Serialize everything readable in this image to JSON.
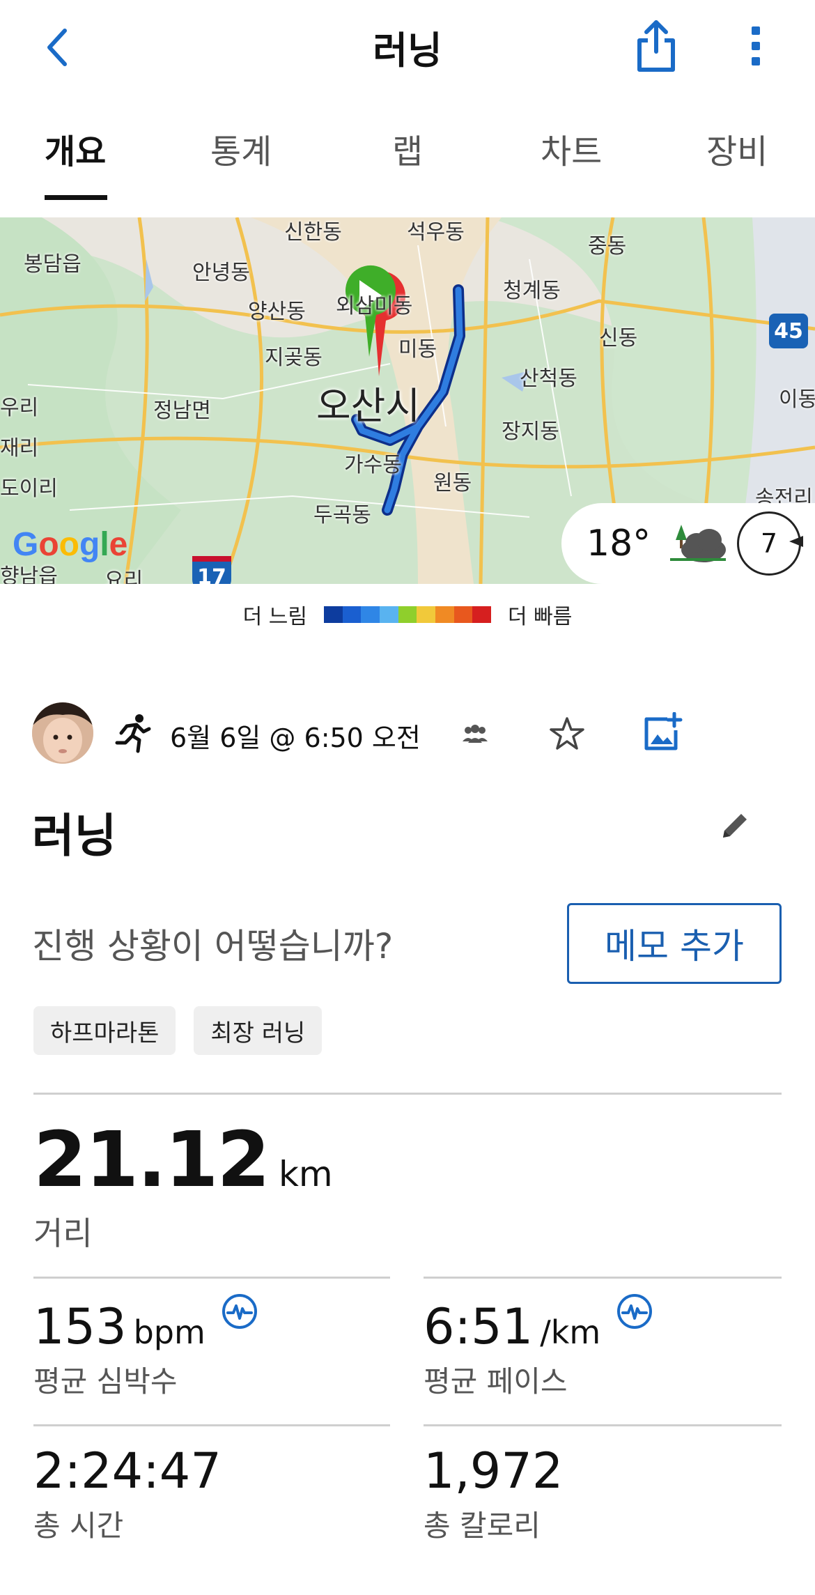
{
  "header": {
    "title": "러닝",
    "back_icon": "chevron-left-icon",
    "share_icon": "share-icon",
    "more_icon": "more-vertical-icon",
    "accent": "#1a6bc7"
  },
  "tabs": [
    {
      "label": "개요",
      "active": true
    },
    {
      "label": "통계",
      "active": false
    },
    {
      "label": "랩",
      "active": false
    },
    {
      "label": "차트",
      "active": false
    },
    {
      "label": "장비",
      "active": false
    }
  ],
  "map": {
    "city": "오산시",
    "places": [
      "신한동",
      "석우동",
      "중동",
      "봉담읍",
      "안녕동",
      "양산동",
      "외삼미동",
      "청계동",
      "지곶동",
      "미동",
      "신동",
      "산척동",
      "우리",
      "정남면",
      "이동",
      "장지동",
      "재리",
      "가수동",
      "원동",
      "도이리",
      "두곡동",
      "송전리",
      "향남읍",
      "요리"
    ],
    "route_shields": [
      "45",
      "17"
    ],
    "google_logo": "Google",
    "weather": {
      "temperature": "18°",
      "wind_speed": "7",
      "condition_icon": "cloud-tree-icon"
    }
  },
  "legend": {
    "slow_label": "더 느림",
    "fast_label": "더 빠름",
    "colors": [
      "#0d3c9e",
      "#1a5fd0",
      "#2f86e6",
      "#59b3f0",
      "#8fcf2c",
      "#f1c93a",
      "#f08a24",
      "#e8581e",
      "#d61f1f"
    ]
  },
  "activity": {
    "type_icon": "running-icon",
    "date_time": "6월 6일 @ 6:50 오전",
    "title": "러닝",
    "prompt": "진행 상황이 어떻습니까?",
    "memo_button": "메모 추가",
    "tags": [
      "하프마라톤",
      "최장 러닝"
    ]
  },
  "stats": {
    "distance": {
      "value": "21.12",
      "unit": "km",
      "label": "거리"
    },
    "avg_heart_rate": {
      "value": "153",
      "unit": "bpm",
      "label": "평균 심박수"
    },
    "avg_pace": {
      "value": "6:51",
      "unit": "/km",
      "label": "평균 페이스"
    },
    "total_time": {
      "value": "2:24:47",
      "label": "총 시간"
    },
    "total_calories": {
      "value": "1,972",
      "label": "총 칼로리"
    }
  }
}
